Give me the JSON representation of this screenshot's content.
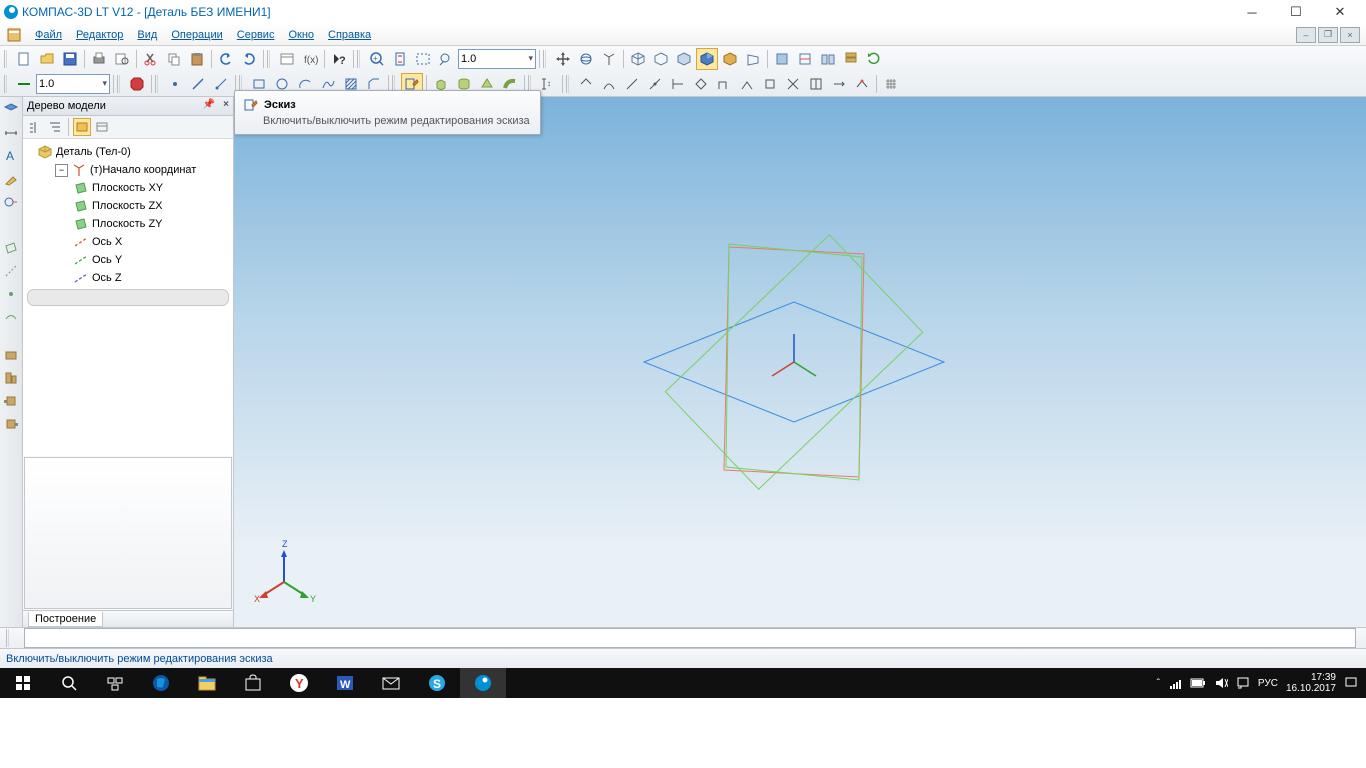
{
  "title": "КОМПАС-3D LT V12 - [Деталь БЕЗ ИМЕНИ1]",
  "menu": {
    "file": "Файл",
    "editor": "Редактор",
    "view": "Вид",
    "operations": "Операции",
    "service": "Сервис",
    "window": "Окно",
    "help": "Справка"
  },
  "toolbar": {
    "scale_combo": "1.0",
    "scale_combo2": "1.0"
  },
  "panel": {
    "title": "Дерево модели",
    "root": "Деталь (Тел-0)",
    "origin": "(т)Начало координат",
    "plane_xy": "Плоскость XY",
    "plane_zx": "Плоскость ZX",
    "plane_zy": "Плоскость ZY",
    "axis_x": "Ось X",
    "axis_y": "Ось Y",
    "axis_z": "Ось Z"
  },
  "mode_tab": "Построение",
  "tooltip": {
    "title": "Эскиз",
    "body": "Включить/выключить режим редактирования эскиза"
  },
  "hint": "Включить/выключить режим редактирования эскиза",
  "triad": {
    "x": "X",
    "y": "Y",
    "z": "Z"
  },
  "tray": {
    "lang": "РУС",
    "time": "17:39",
    "date": "16.10.2017"
  }
}
